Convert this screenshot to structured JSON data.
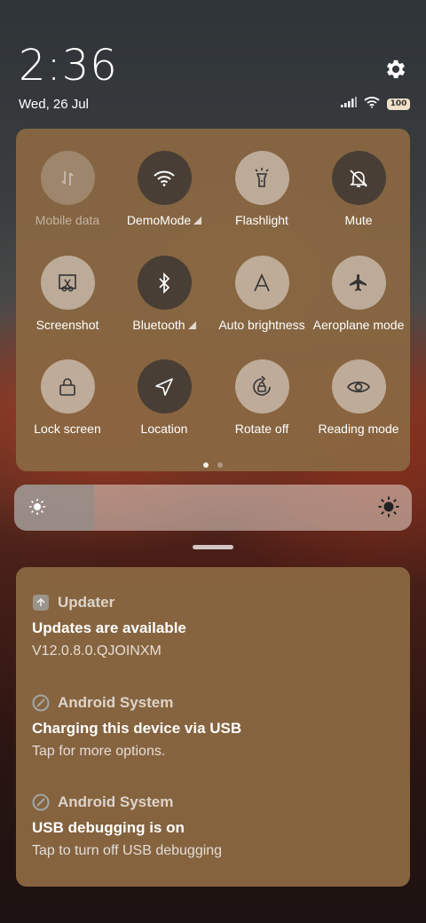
{
  "status": {
    "time": "2:36",
    "date": "Wed, 26 Jul",
    "battery": "100",
    "icons": [
      "signal-icon",
      "wifi-icon",
      "battery-icon"
    ]
  },
  "quick_settings": {
    "tiles": [
      {
        "label": "Mobile data",
        "icon": "mobile-data-icon",
        "state": "disabled"
      },
      {
        "label": "DemoMode",
        "icon": "wifi-icon",
        "state": "on",
        "has_more": true
      },
      {
        "label": "Flashlight",
        "icon": "flashlight-icon",
        "state": "off"
      },
      {
        "label": "Mute",
        "icon": "bell-off-icon",
        "state": "on"
      },
      {
        "label": "Screenshot",
        "icon": "screenshot-icon",
        "state": "off"
      },
      {
        "label": "Bluetooth",
        "icon": "bluetooth-icon",
        "state": "on",
        "has_more": true
      },
      {
        "label": "Auto brightness",
        "icon": "auto-brightness-icon",
        "state": "off"
      },
      {
        "label": "Aeroplane mode",
        "icon": "airplane-icon",
        "state": "off"
      },
      {
        "label": "Lock screen",
        "icon": "lock-icon",
        "state": "off"
      },
      {
        "label": "Location",
        "icon": "location-icon",
        "state": "on"
      },
      {
        "label": "Rotate off",
        "icon": "rotation-lock-icon",
        "state": "off"
      },
      {
        "label": "Reading mode",
        "icon": "eye-icon",
        "state": "off"
      }
    ],
    "pages": 2,
    "current_page": 1
  },
  "brightness": {
    "level": 0.2
  },
  "notifications": [
    {
      "app": "Updater",
      "title": "Updates are available",
      "body": "V12.0.8.0.QJOINXM",
      "icon": "updater-icon"
    },
    {
      "app": "Android System",
      "title": "Charging this device via USB",
      "body": "Tap for more options.",
      "icon": "android-system-icon"
    },
    {
      "app": "Android System",
      "title": "USB debugging is on",
      "body": "Tap to turn off USB debugging",
      "icon": "android-system-icon"
    }
  ],
  "colors": {
    "panel": "#896742",
    "tile_on": "#413a34",
    "tile_off": "#ebe6e1"
  }
}
